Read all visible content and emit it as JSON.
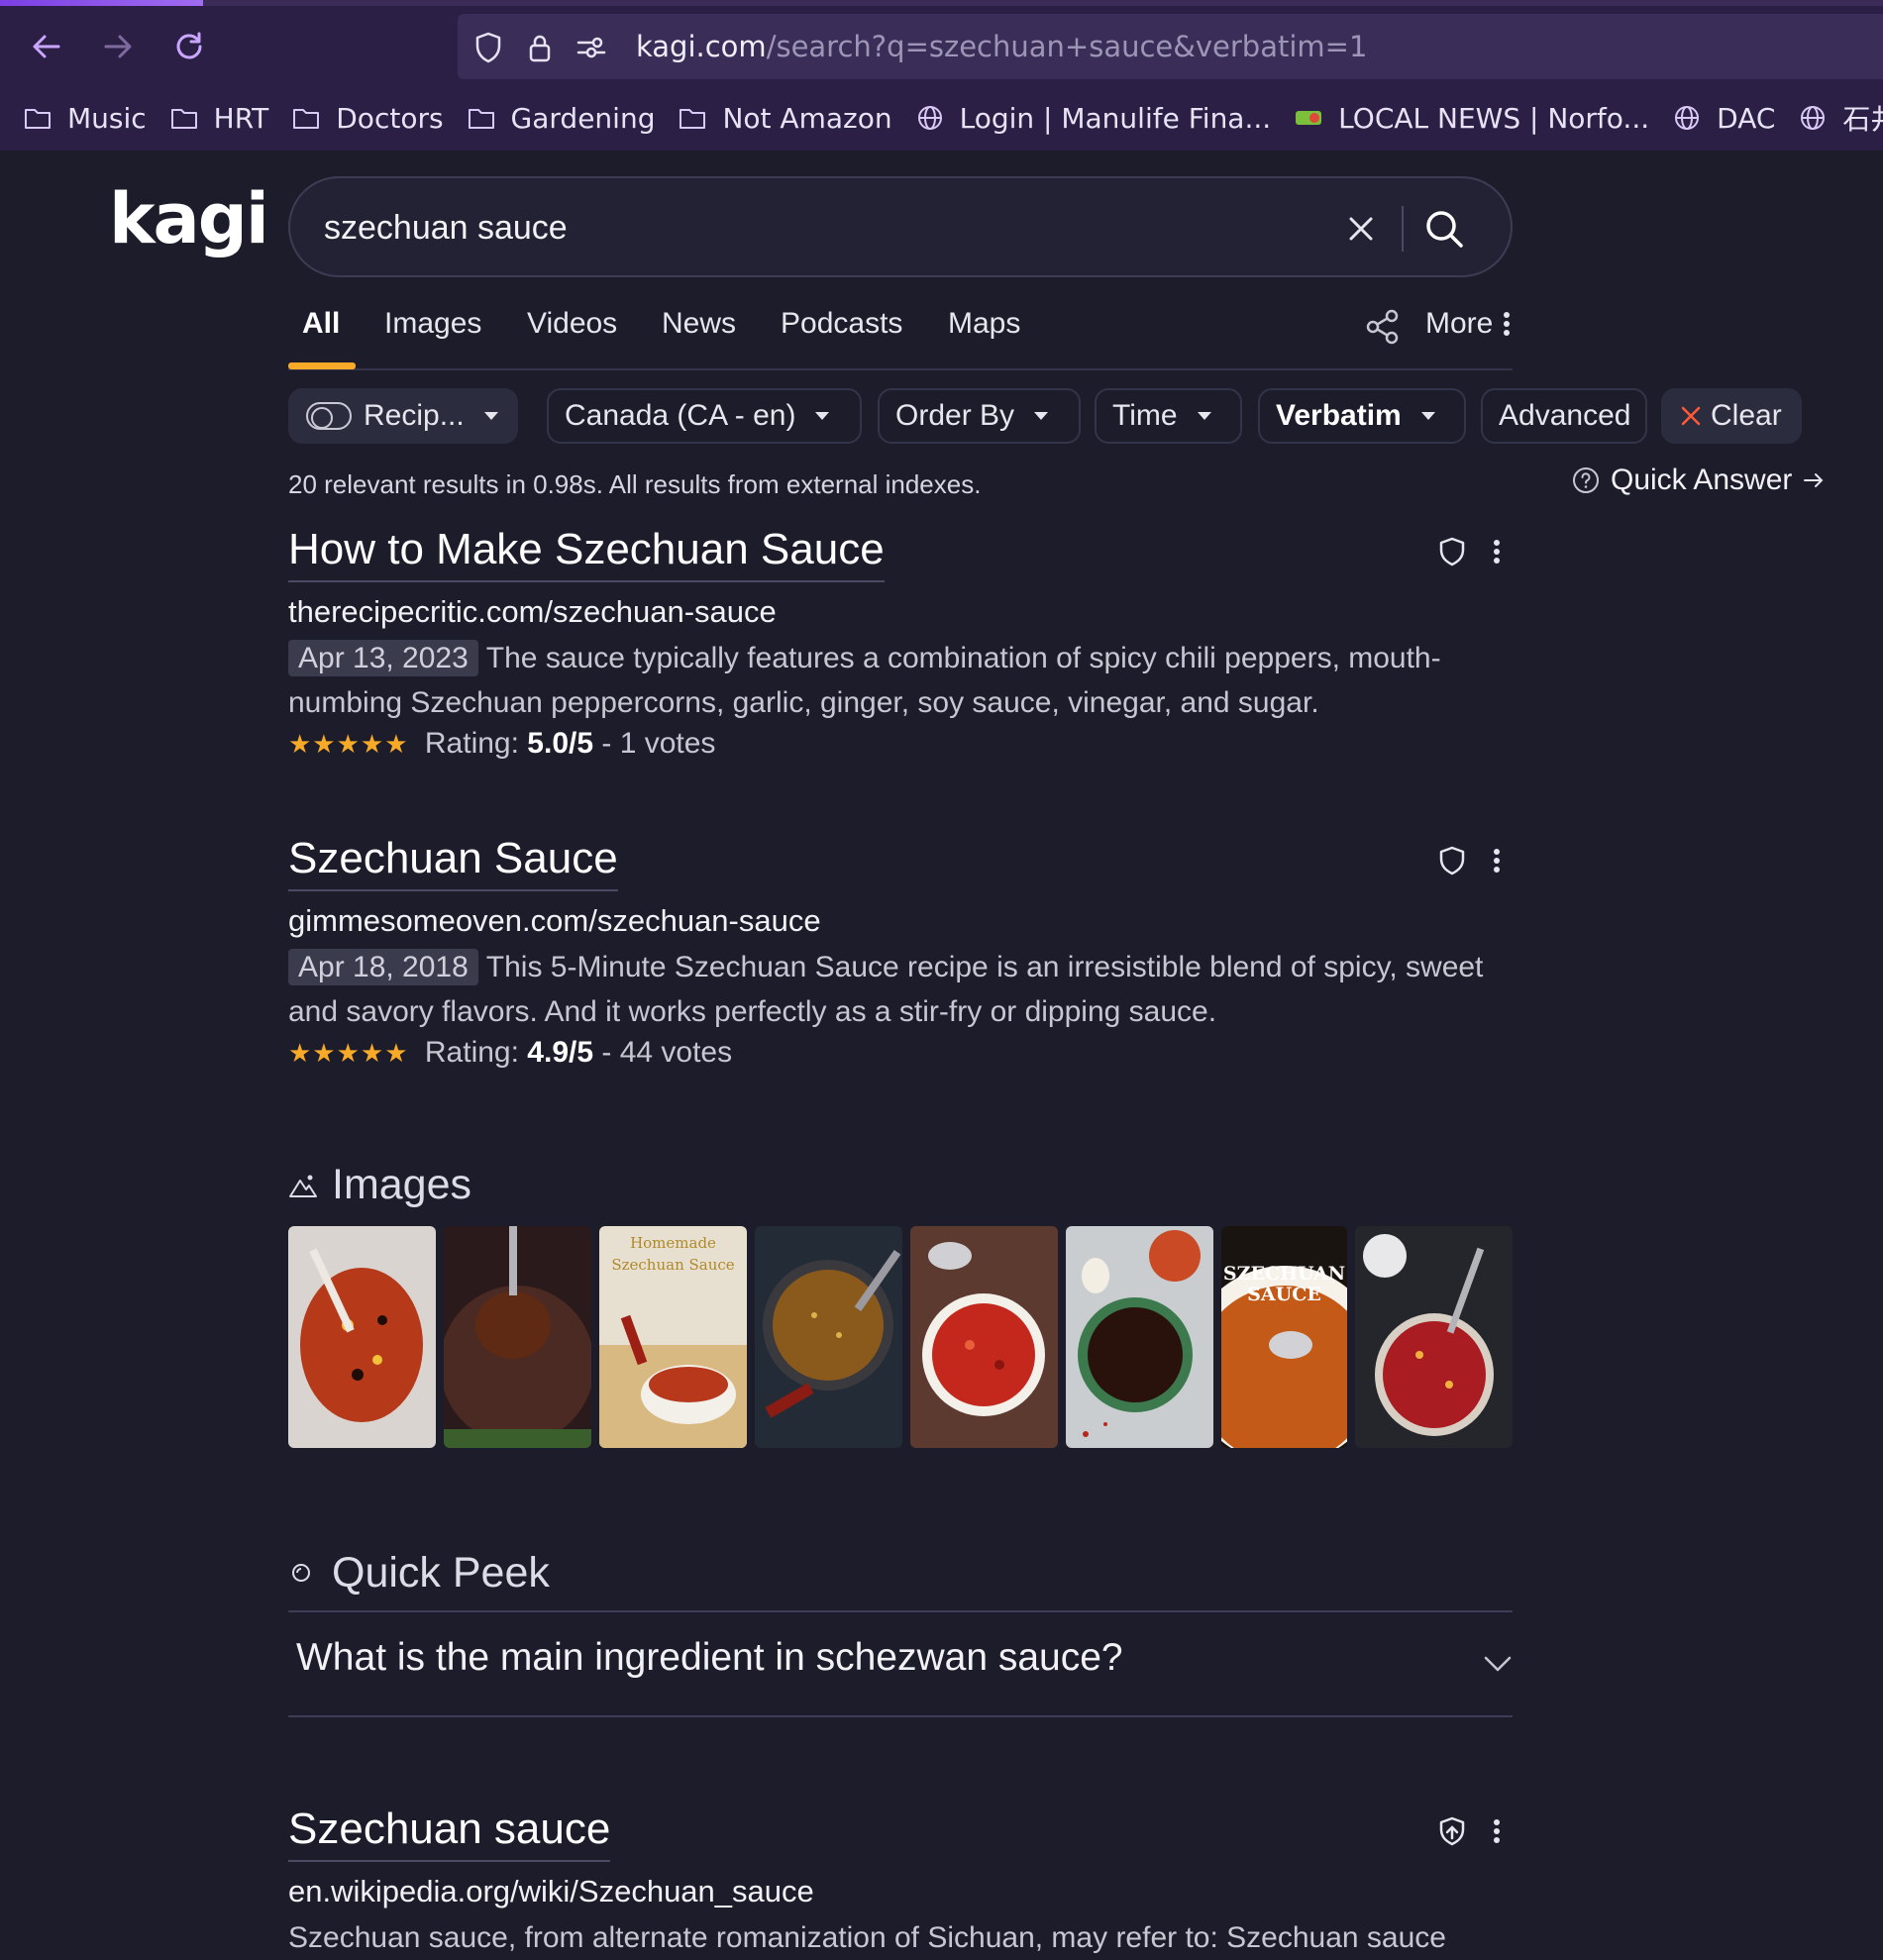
{
  "browser": {
    "url_host": "kagi.com",
    "url_path": "/search?q=szechuan+sauce&verbatim=1",
    "bookmarks": [
      {
        "label": "Music",
        "icon": "folder-icon"
      },
      {
        "label": "HRT",
        "icon": "folder-icon"
      },
      {
        "label": "Doctors",
        "icon": "folder-icon"
      },
      {
        "label": "Gardening",
        "icon": "folder-icon"
      },
      {
        "label": "Not Amazon",
        "icon": "folder-icon"
      },
      {
        "label": "Login | Manulife Fina...",
        "icon": "globe-icon"
      },
      {
        "label": "LOCAL NEWS | Norfo...",
        "icon": "site-favicon"
      },
      {
        "label": "DAC",
        "icon": "globe-icon"
      },
      {
        "label": "石井妥師//info/",
        "icon": "globe-icon"
      }
    ]
  },
  "brand": {
    "logo": "kagi",
    "accent": "#f7a928"
  },
  "search": {
    "query": "szechuan sauce"
  },
  "tabs": {
    "all": "All",
    "images": "Images",
    "videos": "Videos",
    "news": "News",
    "podcasts": "Podcasts",
    "maps": "Maps",
    "more": "More"
  },
  "filters": {
    "recipes": "Recip...",
    "region": "Canada (CA - en)",
    "order": "Order By",
    "time": "Time",
    "verbatim": "Verbatim",
    "advanced": "Advanced",
    "clear": "Clear"
  },
  "stats": "20 relevant results in 0.98s. All results from external indexes.",
  "quick_answer": "Quick Answer",
  "results": [
    {
      "title": "How to Make Szechuan Sauce",
      "url": "therecipecritic.com/szechuan-sauce",
      "date": "Apr 13, 2023",
      "snippet": "The sauce typically features a combination of spicy chili peppers, mouth-numbing Szechuan peppercorns, garlic, ginger, soy sauce, vinegar, and sugar.",
      "stars": "★★★★★",
      "rating_label": "Rating:",
      "rating": "5.0/5",
      "votes": "- 1 votes"
    },
    {
      "title": "Szechuan Sauce",
      "url": "gimmesomeoven.com/szechuan-sauce",
      "date": "Apr 18, 2018",
      "snippet": "This 5-Minute Szechuan Sauce recipe is an irresistible blend of spicy, sweet and savory flavors. And it works perfectly as a stir-fry or dipping sauce.",
      "stars": "★★★★★",
      "rating_label": "Rating:",
      "rating": "4.9/5",
      "votes": "- 44 votes"
    },
    {
      "title": "Szechuan sauce",
      "url": "en.wikipedia.org/wiki/Szechuan_sauce",
      "snippet": "Szechuan sauce, from alternate romanization of Sichuan, may refer to: Szechuan sauce"
    }
  ],
  "images_section": {
    "heading": "Images",
    "thumb3_text_1": "Homemade",
    "thumb3_text_2": "Szechuan Sauce",
    "thumb7_text_1": "SZECHUAN",
    "thumb7_text_2": "SAUCE"
  },
  "quick_peek": {
    "heading": "Quick Peek",
    "question": "What is the main ingredient in schezwan sauce?"
  }
}
